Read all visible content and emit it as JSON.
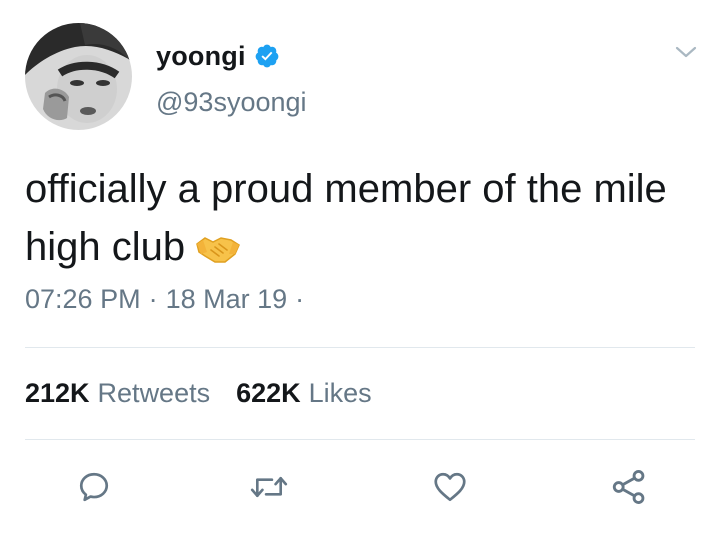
{
  "user": {
    "display_name": "yoongi",
    "handle": "@93syoongi",
    "verified": true
  },
  "tweet": {
    "text": "officially a proud member of the mile high club",
    "emoji": "handshake-emoji"
  },
  "meta": {
    "time": "07:26 PM",
    "separator": "·",
    "date": "18 Mar 19",
    "trailing_separator": "·"
  },
  "stats": {
    "retweets_count": "212K",
    "retweets_label": "Retweets",
    "likes_count": "622K",
    "likes_label": "Likes"
  },
  "icons": {
    "reply": "reply-icon",
    "retweet": "retweet-icon",
    "like": "heart-icon",
    "share": "share-icon",
    "menu": "chevron-down-icon"
  },
  "colors": {
    "verified_blue": "#1da1f2",
    "secondary_text": "#657786",
    "icon_gray": "#657786",
    "divider": "#e1e8ed"
  }
}
